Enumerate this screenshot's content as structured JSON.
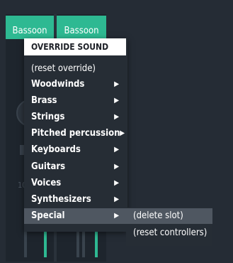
{
  "strips": [
    {
      "name": "Bassoon",
      "knob": "R5",
      "level": "100"
    },
    {
      "name": "Bassoon",
      "knob": "R6",
      "level": "100"
    }
  ],
  "colors": {
    "accent": "#2eb992",
    "menu_bg": "#262d35",
    "highlight": "#4f5761"
  },
  "menu": {
    "title": "OVERRIDE SOUND",
    "items": [
      {
        "label": "(reset override)",
        "submenu": false,
        "bold": false
      },
      {
        "label": "Woodwinds",
        "submenu": true,
        "bold": true
      },
      {
        "label": "Brass",
        "submenu": true,
        "bold": true
      },
      {
        "label": "Strings",
        "submenu": true,
        "bold": true
      },
      {
        "label": "Pitched percussion",
        "submenu": true,
        "bold": true
      },
      {
        "label": "Keyboards",
        "submenu": true,
        "bold": true
      },
      {
        "label": "Guitars",
        "submenu": true,
        "bold": true
      },
      {
        "label": "Voices",
        "submenu": true,
        "bold": true
      },
      {
        "label": "Synthesizers",
        "submenu": true,
        "bold": true
      },
      {
        "label": "Special",
        "submenu": true,
        "bold": true,
        "active": true
      }
    ],
    "arrow_icon": "triangle-right-icon",
    "arrow_glyph": "▶"
  },
  "submenu": {
    "items": [
      {
        "label": "(delete slot)",
        "active": true
      },
      {
        "label": "(reset controllers)",
        "active": false
      }
    ]
  }
}
